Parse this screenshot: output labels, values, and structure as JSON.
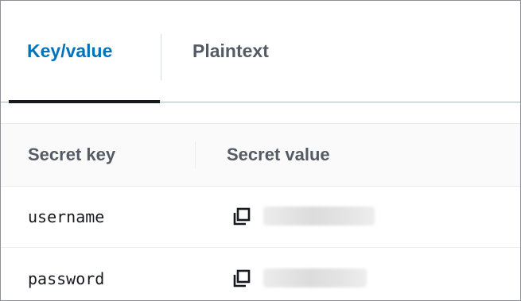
{
  "tabs": [
    {
      "label": "Key/value",
      "active": true
    },
    {
      "label": "Plaintext",
      "active": false
    }
  ],
  "table": {
    "columns": [
      "Secret key",
      "Secret value"
    ],
    "rows": [
      {
        "key": "username",
        "value_masked": true
      },
      {
        "key": "password",
        "value_masked": true
      }
    ]
  },
  "icons": {
    "copy": "copy-icon"
  },
  "colors": {
    "active_tab": "#0073bb",
    "inactive_tab": "#545b64",
    "text": "#16191f"
  }
}
